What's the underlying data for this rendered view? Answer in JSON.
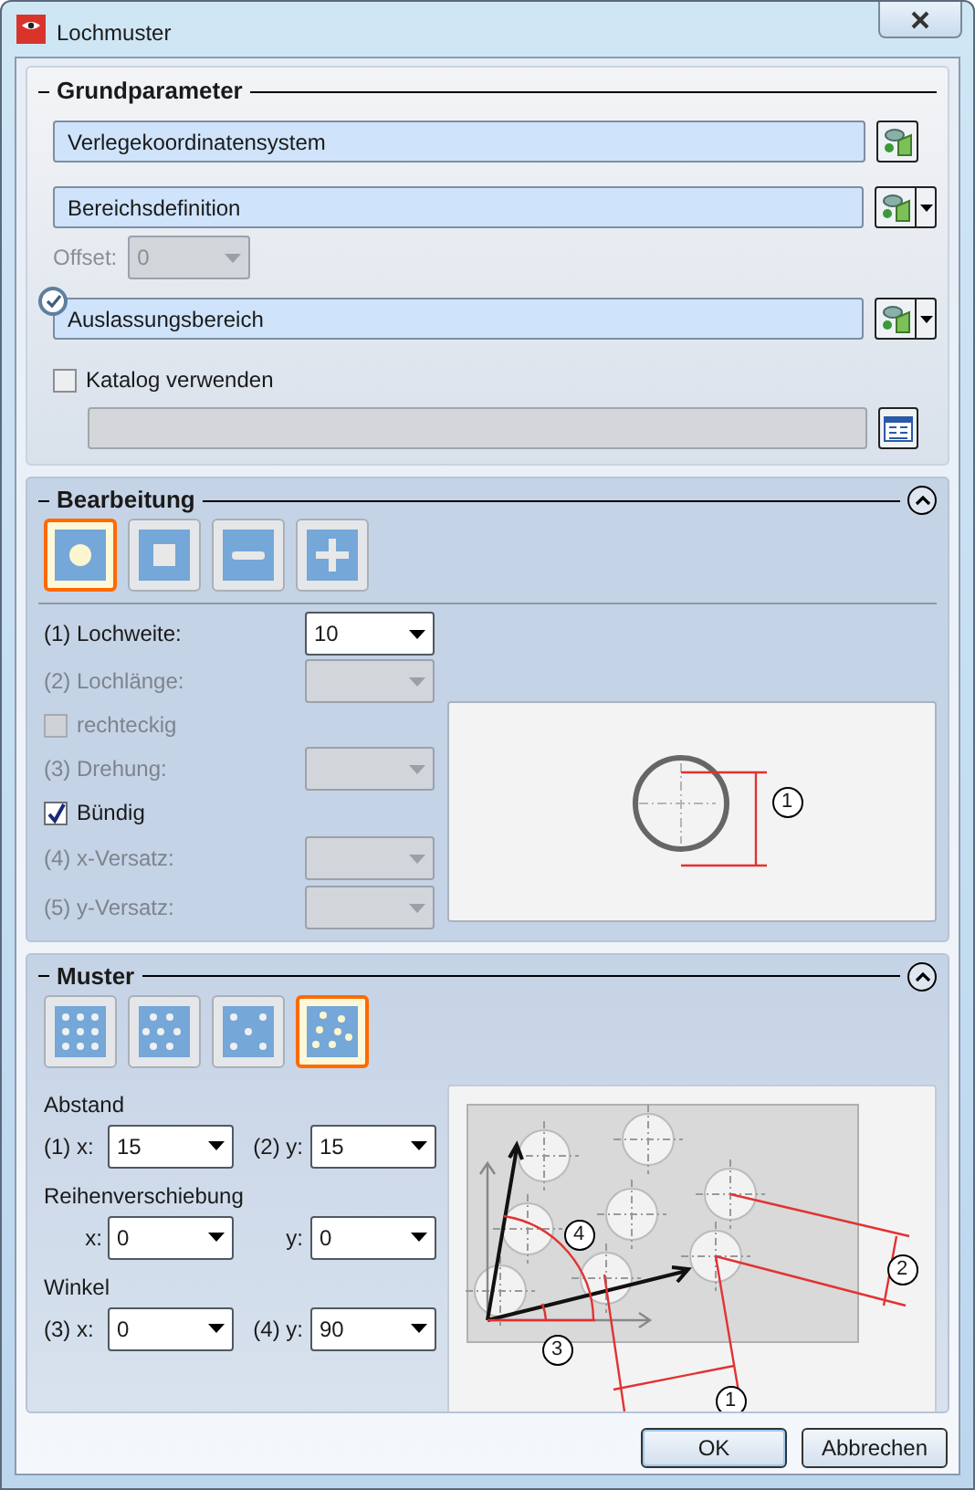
{
  "window": {
    "title": "Lochmuster"
  },
  "grundparameter": {
    "title": "Grundparameter",
    "references": [
      {
        "value": "Verlegekoordinatensystem",
        "has_menu": false,
        "confirmed": false
      },
      {
        "value": "Bereichsdefinition",
        "has_menu": true,
        "confirmed": false
      },
      {
        "value": "Auslassungsbereich",
        "has_menu": true,
        "confirmed": true
      }
    ],
    "offset": {
      "label": "Offset:",
      "value": "0",
      "disabled": true
    },
    "catalog": {
      "label": "Katalog verwenden",
      "checked": false
    },
    "catalog_field": {
      "disabled": true
    }
  },
  "bearbeitung": {
    "title": "Bearbeitung",
    "expanded": true,
    "shapes": [
      {
        "kind": "round",
        "selected": true
      },
      {
        "kind": "square",
        "selected": false
      },
      {
        "kind": "slot",
        "selected": false
      },
      {
        "kind": "cross",
        "selected": false
      }
    ],
    "params": [
      {
        "kind": "combo",
        "label": "(1) Lochweite:",
        "value": "10",
        "disabled": false
      },
      {
        "kind": "combo",
        "label": "(2) Lochlänge:",
        "disabled": true
      },
      {
        "kind": "check",
        "label": "rechteckig",
        "checked": false,
        "disabled": true
      },
      {
        "kind": "combo",
        "label": "(3) Drehung:",
        "disabled": true
      },
      {
        "kind": "check",
        "label": "Bündig",
        "checked": true,
        "disabled": false
      },
      {
        "kind": "combo",
        "label": "(4) x-Versatz:",
        "disabled": true
      },
      {
        "kind": "combo",
        "label": "(5) y-Versatz:",
        "disabled": true
      }
    ],
    "preview": {
      "callouts": [
        "1"
      ]
    }
  },
  "muster": {
    "title": "Muster",
    "expanded": true,
    "patterns": [
      {
        "kind": "grid",
        "selected": false
      },
      {
        "kind": "staggered",
        "selected": false
      },
      {
        "kind": "sparse",
        "selected": false
      },
      {
        "kind": "rotated",
        "selected": true
      }
    ],
    "groups": [
      {
        "title": "Abstand",
        "fields": [
          {
            "label": "(1) x:",
            "value": "15"
          },
          {
            "label": "(2) y:",
            "value": "15"
          }
        ]
      },
      {
        "title": "Reihenverschiebung",
        "fields": [
          {
            "label": "x:",
            "value": "0"
          },
          {
            "label": "y:",
            "value": "0"
          }
        ]
      },
      {
        "title": "Winkel",
        "fields": [
          {
            "label": "(3) x:",
            "value": "0"
          },
          {
            "label": "(4) y:",
            "value": "90"
          }
        ]
      }
    ],
    "preview": {
      "callouts": [
        "4",
        "2",
        "3",
        "1"
      ]
    }
  },
  "buttons": [
    "OK",
    "Abbrechen"
  ]
}
